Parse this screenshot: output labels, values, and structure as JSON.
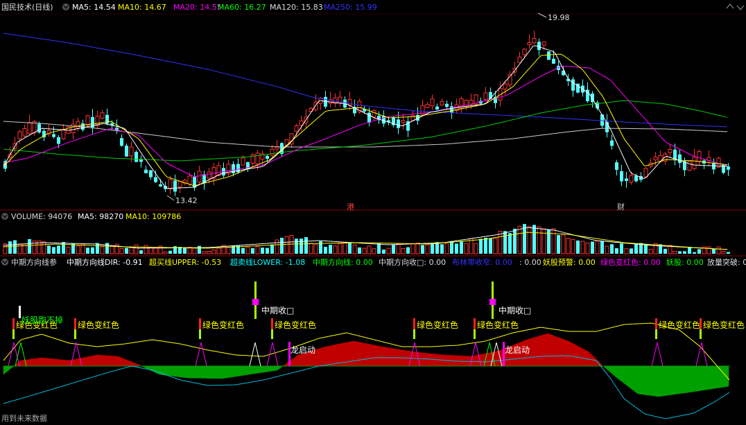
{
  "main_header": {
    "stock": "国民技术(日线)",
    "items": [
      {
        "text": "MA5: 14.54",
        "color": "#ffffff"
      },
      {
        "text": "MA10: 14.67",
        "color": "#ffff00"
      },
      {
        "text": "MA20: 14.55",
        "color": "#ff00ff"
      },
      {
        "text": "MA60: 16.27",
        "color": "#00ff00"
      },
      {
        "text": "MA120: 15.83",
        "color": "#dddddd"
      },
      {
        "text": "MA250: 15.99",
        "color": "#3333ff"
      }
    ]
  },
  "price": {
    "high_label": "19.98",
    "low_label": "13.42",
    "marker_gang": "港",
    "marker_cai": "财"
  },
  "volume_header": {
    "items": [
      {
        "text": "VOLUME: 94076",
        "color": "#dddddd"
      },
      {
        "text": "MA5: 98270",
        "color": "#ffffff"
      },
      {
        "text": "MA10: 109786",
        "color": "#ffff00"
      }
    ]
  },
  "indicator_header": {
    "items": [
      {
        "text": "中期方向线参",
        "color": "#dddddd"
      },
      {
        "text": "中期方向线DIR: -0.91",
        "color": "#ffffff"
      },
      {
        "text": "超买线UPPER: -0.53",
        "color": "#ffff00"
      },
      {
        "text": "超卖线LOWER: -1.08",
        "color": "#00ffff"
      },
      {
        "text": "中期方向线: 0.00",
        "color": "#00ff00"
      },
      {
        "text": "中期方向收□: 0.00",
        "color": "#dddddd"
      },
      {
        "text": "布林带收窄: 0.00",
        "color": "#3333ff"
      },
      {
        "text": ": 0.00",
        "color": "#dddddd"
      },
      {
        "text": "妖股预警: 0.00",
        "color": "#ffff00"
      },
      {
        "text": "绿色变红色: 0.00",
        "color": "#ff00ff"
      },
      {
        "text": "妖股: 0.00",
        "color": "#00ff00"
      },
      {
        "text": "放量突破: 0",
        "color": "#dddddd"
      }
    ]
  },
  "signals": {
    "demon_no_drop": "妖股跑不掉",
    "green_to_red": "绿色变红色",
    "mid_term_close": "中期收□",
    "dragon_start": "龙启动"
  },
  "footer_text": "用到未来数据",
  "colors": {
    "up": "#ff3232",
    "down": "#54ffff",
    "fill_red": "#c00000",
    "fill_green": "#00a000",
    "separator": "#8b0000"
  }
}
